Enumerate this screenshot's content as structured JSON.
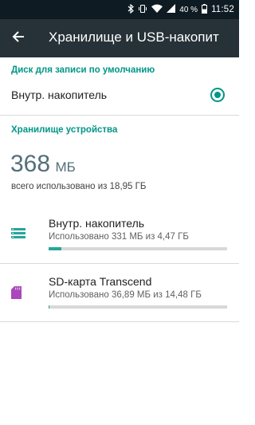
{
  "status_bar": {
    "battery_percent": "40 %",
    "time": "11:52",
    "icons": [
      "bluetooth-icon",
      "vibrate-icon",
      "wifi-icon",
      "signal-icon",
      "battery-icon"
    ]
  },
  "toolbar": {
    "title": "Хранилище и USB-накопит",
    "back_icon": "arrow-back-icon"
  },
  "default_disk": {
    "header": "Диск для записи по умолчанию",
    "option_label": "Внутр. накопитель",
    "selected": true
  },
  "device_storage": {
    "header": "Хранилище устройства",
    "used_value": "368",
    "used_unit": "МБ",
    "total_text": "всего использовано из 18,95 ГБ"
  },
  "items": [
    {
      "icon": "internal-storage-icon",
      "title": "Внутр. накопитель",
      "subtitle": "Использовано 331 МБ из 4,47 ГБ",
      "used_fraction": 0.072
    },
    {
      "icon": "sd-card-icon",
      "title": "SD-карта Transcend",
      "subtitle": "Использовано 36,89 МБ из 14,48 ГБ",
      "used_fraction": 0.0025
    }
  ],
  "colors": {
    "accent": "#009688",
    "toolbar": "#263238",
    "status_bar": "#0e1b22",
    "internal_icon": "#26a69a",
    "sd_icon": "#ab47bc",
    "progress_fill": "#26a69a",
    "progress_track": "#d8d8d8"
  }
}
